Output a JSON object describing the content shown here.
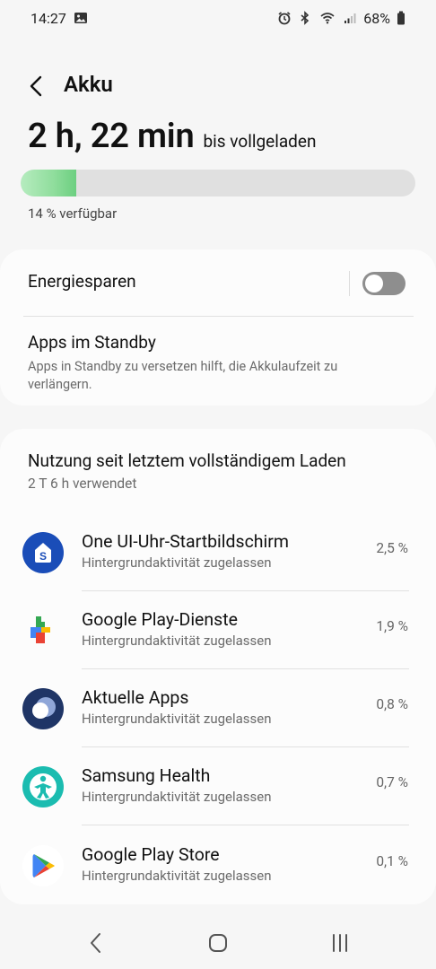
{
  "status_bar": {
    "time": "14:27",
    "battery_percent": "68%",
    "icons_left": [
      "image-notification-icon"
    ],
    "icons_right": [
      "alarm-icon",
      "bluetooth-icon",
      "wifi-icon",
      "signal-icon",
      "battery-icon"
    ]
  },
  "header": {
    "title": "Akku",
    "back_icon": "chevron-left-icon"
  },
  "charging": {
    "time_remaining": "2 h, 22 min",
    "suffix": "bis vollgeladen",
    "level": 0.14,
    "available_text": "14 % verfügbar",
    "bar_color": "#8fdd9c"
  },
  "settings": {
    "power_saving": {
      "label": "Energiesparen",
      "enabled": false
    },
    "standby": {
      "label": "Apps im Standby",
      "description_line1": "Apps in Standby zu versetzen hilft, die Akkulaufzeit zu",
      "description_line2": "verlängern."
    }
  },
  "usage": {
    "title": "Nutzung seit letztem vollständigem Laden",
    "subtitle": "2 T 6 h verwendet",
    "apps": [
      {
        "name": "One UI-Uhr-Startbildschirm",
        "status": "Hintergrundaktivität zugelassen",
        "percent": "2,5 %",
        "icon": "oneui-watch-icon"
      },
      {
        "name": "Google Play-Dienste",
        "status": "Hintergrundaktivität zugelassen",
        "percent": "1,9 %",
        "icon": "google-play-services-icon"
      },
      {
        "name": "Aktuelle Apps",
        "status": "Hintergrundaktivität zugelassen",
        "percent": "0,8 %",
        "icon": "recent-apps-icon"
      },
      {
        "name": "Samsung Health",
        "status": "Hintergrundaktivität zugelassen",
        "percent": "0,7 %",
        "icon": "samsung-health-icon"
      },
      {
        "name": "Google Play Store",
        "status": "Hintergrundaktivität zugelassen",
        "percent": "0,1 %",
        "icon": "google-play-store-icon"
      }
    ]
  },
  "navigation": {
    "icons": [
      "nav-back-icon",
      "nav-home-icon",
      "nav-recents-icon"
    ]
  }
}
